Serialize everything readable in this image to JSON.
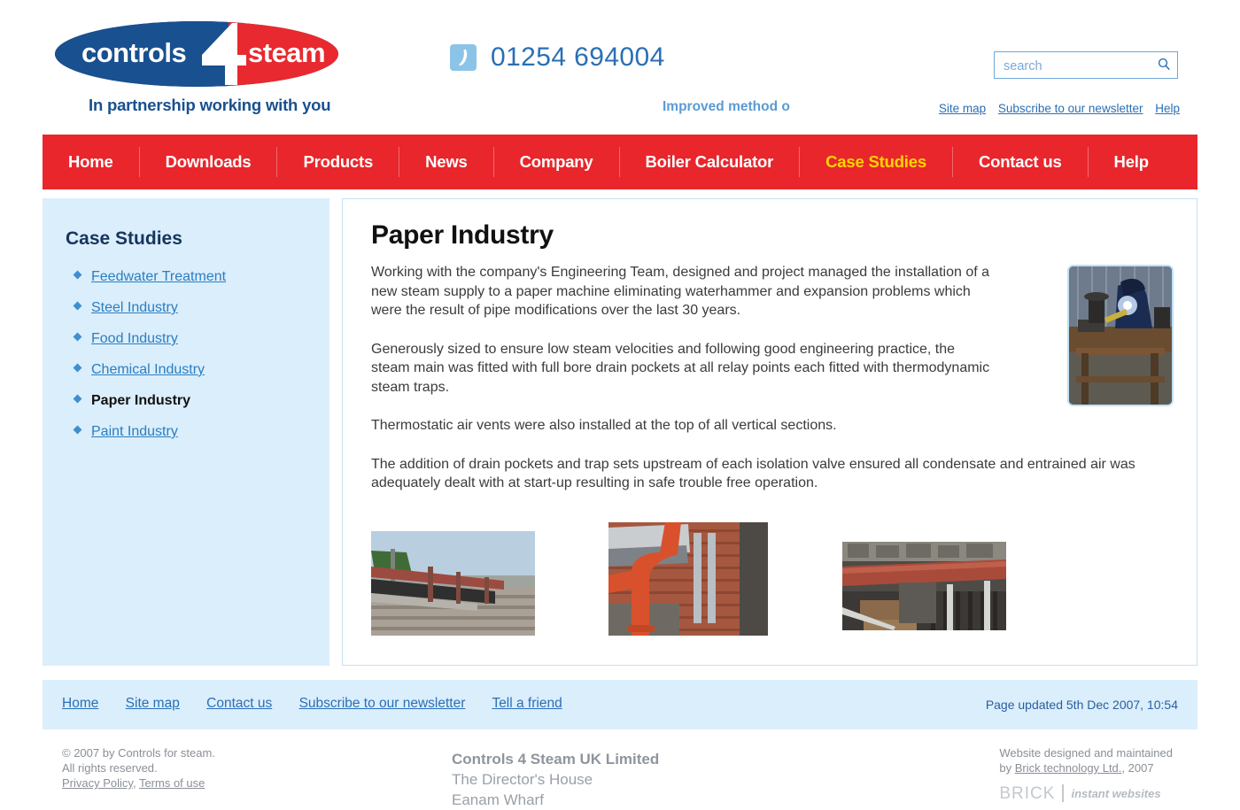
{
  "header": {
    "logo": {
      "word_left": "controls",
      "numeral": "4",
      "word_right": "steam",
      "tagline": "In partnership working with you",
      "color_blue": "#19508f",
      "color_red": "#e8292f"
    },
    "phone": {
      "icon": "phone-icon",
      "number": "01254 694004"
    },
    "ticker": {
      "text": "Improved method o"
    },
    "search": {
      "placeholder": "search",
      "value": "",
      "icon": "search-icon"
    },
    "utility_links": [
      {
        "label": "Site map"
      },
      {
        "label": "Subscribe to our newsletter"
      },
      {
        "label": "Help"
      }
    ]
  },
  "nav": {
    "accent_color": "#e8262c",
    "active_color": "#ffd400",
    "items": [
      {
        "label": "Home",
        "active": false
      },
      {
        "label": "Downloads",
        "active": false
      },
      {
        "label": "Products",
        "active": false
      },
      {
        "label": "News",
        "active": false
      },
      {
        "label": "Company",
        "active": false
      },
      {
        "label": "Boiler Calculator",
        "active": false
      },
      {
        "label": "Case Studies",
        "active": true
      },
      {
        "label": "Contact us",
        "active": false
      },
      {
        "label": "Help",
        "active": false
      }
    ]
  },
  "sidebar": {
    "title": "Case Studies",
    "items": [
      {
        "label": "Feedwater Treatment",
        "active": false
      },
      {
        "label": "Steel Industry",
        "active": false
      },
      {
        "label": "Food Industry",
        "active": false
      },
      {
        "label": "Chemical Industry",
        "active": false
      },
      {
        "label": "Paper Industry",
        "active": true
      },
      {
        "label": "Paint Industry",
        "active": false
      }
    ]
  },
  "main": {
    "title": "Paper Industry",
    "paragraphs": [
      "Working with the company's Engineering Team, designed and project managed the installation of a new steam supply to a paper machine eliminating waterhammer and expansion problems which were the result of pipe modifications over the last 30 years.",
      "Generously sized to ensure low steam velocities and following good engineering practice, the steam main was fitted with full bore drain pockets at all relay points each fitted with thermodynamic steam traps.",
      "Thermostatic air vents were also installed at the top of all vertical sections.",
      "The addition of drain pockets and trap sets upstream of each isolation valve ensured all condensate and entrained air was adequately dealt with at start-up resulting in safe trouble free operation."
    ],
    "side_photo": {
      "name": "welder-photo"
    },
    "thumbnails": [
      {
        "name": "rooftop-pipework-photo"
      },
      {
        "name": "red-pipe-bend-photo"
      },
      {
        "name": "red-pipe-run-photo"
      }
    ]
  },
  "footer": {
    "links": [
      {
        "label": "Home"
      },
      {
        "label": "Site map"
      },
      {
        "label": "Contact us"
      },
      {
        "label": "Subscribe to our newsletter"
      },
      {
        "label": "Tell a friend"
      }
    ],
    "updated": "Page updated 5th Dec 2007, 10:54"
  },
  "legal": {
    "copyright_line1": "© 2007 by Controls for steam.",
    "copyright_line2": "All rights reserved.",
    "privacy_label": "Privacy Policy",
    "legal_separator": ", ",
    "terms_label": "Terms of use",
    "company_name": "Controls 4 Steam UK Limited",
    "address_line1": "The Director's House",
    "address_line2": "Eanam Wharf",
    "credit_line1": "Website designed and maintained",
    "credit_prefix": "by ",
    "credit_link": "Brick technology Ltd.",
    "credit_suffix": ", 2007",
    "brick_word": "BRICK",
    "brick_tagline": "instant websites"
  }
}
